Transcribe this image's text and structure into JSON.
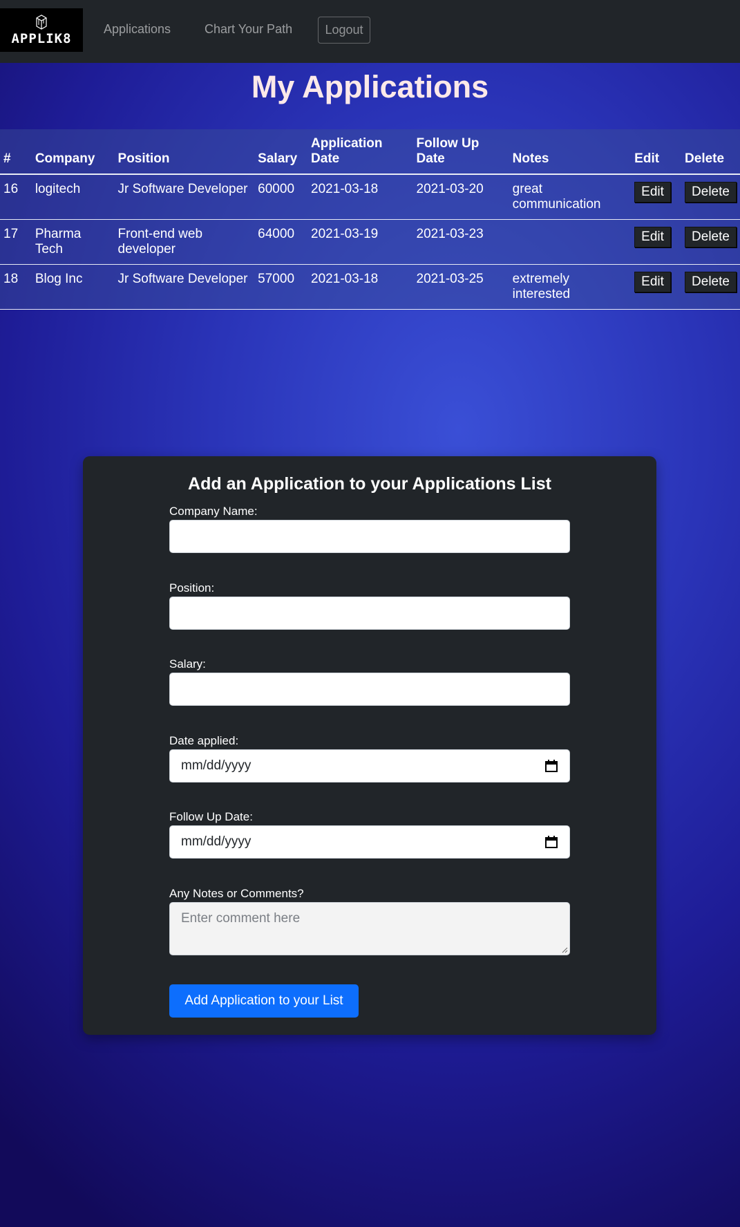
{
  "navbar": {
    "logo_text": "APPLIK8",
    "logo_icon": "cube-icon",
    "links": [
      "Applications",
      "Chart Your Path"
    ],
    "logout_label": "Logout"
  },
  "page": {
    "title": "My Applications"
  },
  "table": {
    "headers": [
      "#",
      "Company",
      "Position",
      "Salary",
      "Application Date",
      "Follow Up Date",
      "Notes",
      "Edit",
      "Delete"
    ],
    "rows": [
      {
        "id": "16",
        "company": "logitech",
        "position": "Jr Software Developer",
        "salary": "60000",
        "app_date": "2021-03-18",
        "follow_up": "2021-03-20",
        "notes": "great communication",
        "edit": "Edit",
        "delete": "Delete"
      },
      {
        "id": "17",
        "company": "Pharma Tech",
        "position": "Front-end web developer",
        "salary": "64000",
        "app_date": "2021-03-19",
        "follow_up": "2021-03-23",
        "notes": "",
        "edit": "Edit",
        "delete": "Delete"
      },
      {
        "id": "18",
        "company": "Blog Inc",
        "position": "Jr Software Developer",
        "salary": "57000",
        "app_date": "2021-03-18",
        "follow_up": "2021-03-25",
        "notes": "extremely interested",
        "edit": "Edit",
        "delete": "Delete"
      }
    ]
  },
  "form": {
    "title": "Add an Application to your Applications List",
    "company_label": "Company Name:",
    "company_value": "",
    "position_label": "Position:",
    "position_value": "",
    "salary_label": "Salary:",
    "salary_value": "",
    "date_applied_label": "Date applied:",
    "date_applied_placeholder": "mm/dd/yyyy",
    "follow_up_label": "Follow Up Date:",
    "follow_up_placeholder": "mm/dd/yyyy",
    "notes_label": "Any Notes or Comments?",
    "notes_placeholder": "Enter comment here",
    "submit_label": "Add Application to your List"
  },
  "colors": {
    "navbar_bg": "#212529",
    "card_bg": "#212529",
    "primary_button": "#0d6efd",
    "title_color": "#fce9e9"
  }
}
